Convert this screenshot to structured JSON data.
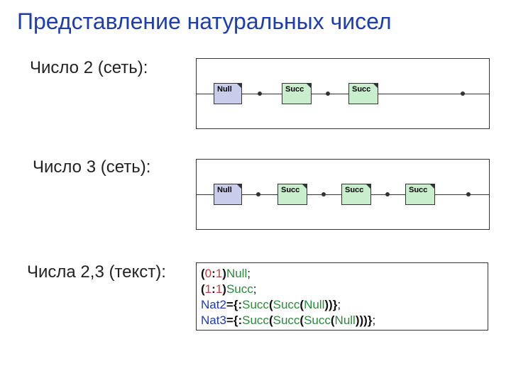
{
  "title": "Представление натуральных чисел",
  "sections": {
    "num2": {
      "label": "Число 2 (сеть):"
    },
    "num3": {
      "label": "Число 3 (сеть):"
    },
    "text": {
      "label": "Числа 2,3 (текст):"
    }
  },
  "nodes": {
    "null": "Null",
    "succ": "Succ"
  },
  "code": {
    "zero": "0",
    "one": "1",
    "colon": ":",
    "lp": "(",
    "rp": ")",
    "semi": ";",
    "openExpr": "={:",
    "close2": "))}",
    "close3": ")))}",
    "Null": "Null",
    "Succ": "Succ",
    "Nat2": "Nat2",
    "Nat3": "Nat3"
  },
  "chart_data": [
    {
      "type": "diagram",
      "title": "Число 2 (сеть)",
      "chain": [
        "Null",
        "Succ",
        "Succ"
      ]
    },
    {
      "type": "diagram",
      "title": "Число 3 (сеть)",
      "chain": [
        "Null",
        "Succ",
        "Succ",
        "Succ"
      ]
    }
  ]
}
